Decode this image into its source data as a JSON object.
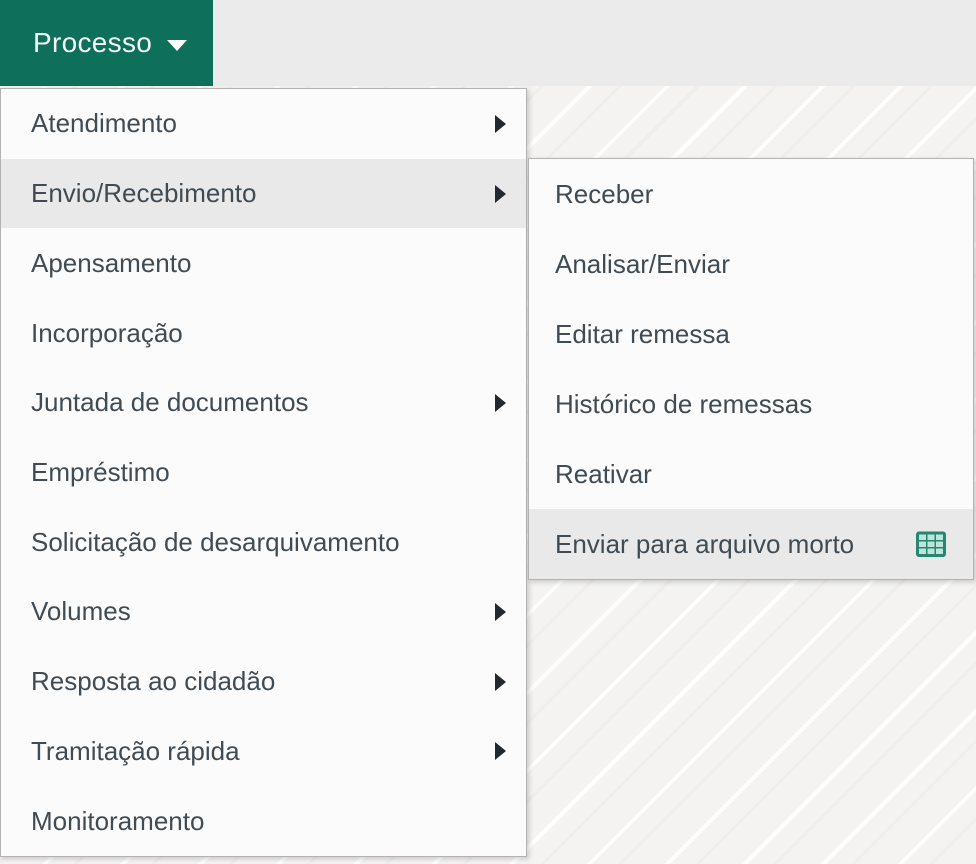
{
  "header": {
    "menu_button": {
      "label": "Processo",
      "icon": "caret-down-icon"
    }
  },
  "main_menu": {
    "items": [
      {
        "label": "Atendimento",
        "has_submenu": true
      },
      {
        "label": "Envio/Recebimento",
        "has_submenu": true,
        "hovered": true
      },
      {
        "label": "Apensamento"
      },
      {
        "label": "Incorporação"
      },
      {
        "label": "Juntada de documentos",
        "has_submenu": true
      },
      {
        "label": "Empréstimo"
      },
      {
        "label": "Solicitação de desarquivamento"
      },
      {
        "label": "Volumes",
        "has_submenu": true
      },
      {
        "label": "Resposta ao cidadão",
        "has_submenu": true
      },
      {
        "label": "Tramitação rápida",
        "has_submenu": true
      },
      {
        "label": "Monitoramento"
      }
    ]
  },
  "submenu": {
    "parent": "Envio/Recebimento",
    "items": [
      {
        "label": "Receber"
      },
      {
        "label": "Analisar/Enviar"
      },
      {
        "label": "Editar remessa"
      },
      {
        "label": "Histórico de remessas"
      },
      {
        "label": "Reativar"
      },
      {
        "label": "Enviar para arquivo morto",
        "hovered": true,
        "icon": "table-icon"
      }
    ]
  },
  "colors": {
    "accent_green": "#0e6f5b",
    "icon_green": "#27866f",
    "icon_cell_green": "#bfe4da",
    "hover_gray": "#e9e9e9",
    "text": "#414b53"
  }
}
